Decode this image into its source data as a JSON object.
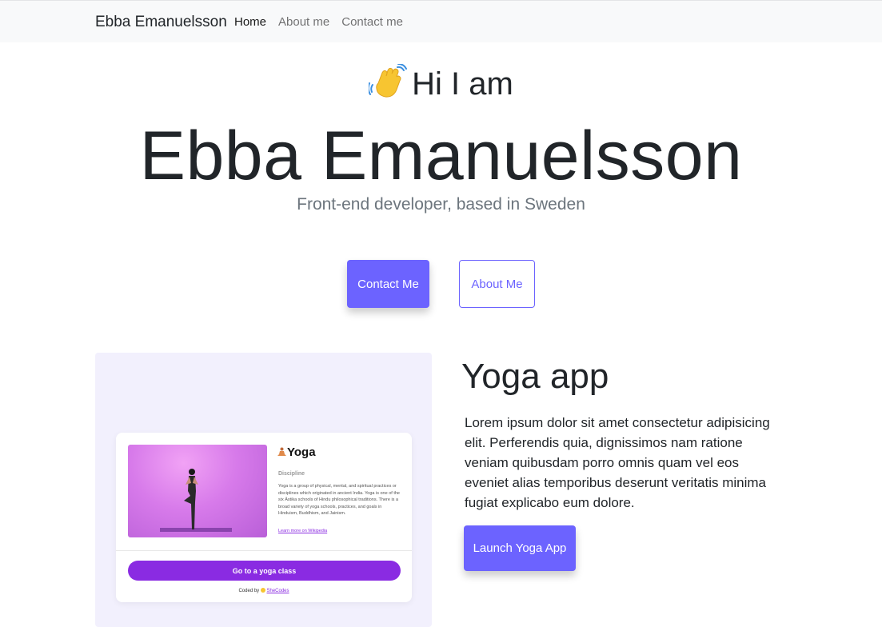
{
  "navbar": {
    "brand": "Ebba Emanuelsson",
    "links": [
      {
        "label": "Home",
        "active": true
      },
      {
        "label": "About me",
        "active": false
      },
      {
        "label": "Contact me",
        "active": false
      }
    ]
  },
  "hero": {
    "wave_icon": "waving-hand-icon",
    "greeting": "Hi I am",
    "name": "Ebba Emanuelsson",
    "subtitle": "Front-end developer, based in Sweden",
    "contact_button": "Contact Me",
    "about_button": "About Me"
  },
  "project": {
    "title": "Yoga app",
    "description": "Lorem ipsum dolor sit amet consectetur adipisicing elit. Perferendis quia, dignissimos nam ratione veniam quibusdam porro omnis quam vel eos eveniet alias temporibus deserunt veritatis minima fugiat explicabo eum dolore.",
    "launch_button": "Launch Yoga App",
    "preview": {
      "icon": "meditation-icon",
      "title": "Yoga",
      "subheading": "Discipline",
      "body": "Yoga is a group of physical, mental, and spiritual practices or disciplines which originated in ancient India. Yoga is one of the six Āstika schools of Hindu philosophical traditions. There is a broad variety of yoga schools, practices, and goals in Hinduism, Buddhism, and Jainism.",
      "link": "Learn more on Wikipedia",
      "button": "Go to a yoga class",
      "footer_prefix": "Coded by",
      "footer_link": "SheCodes"
    }
  },
  "colors": {
    "accent": "#6c63ff",
    "navbar_bg": "#f8f9fa",
    "card_bg": "#f2f0fd",
    "yoga_purple": "#8a2be2"
  }
}
